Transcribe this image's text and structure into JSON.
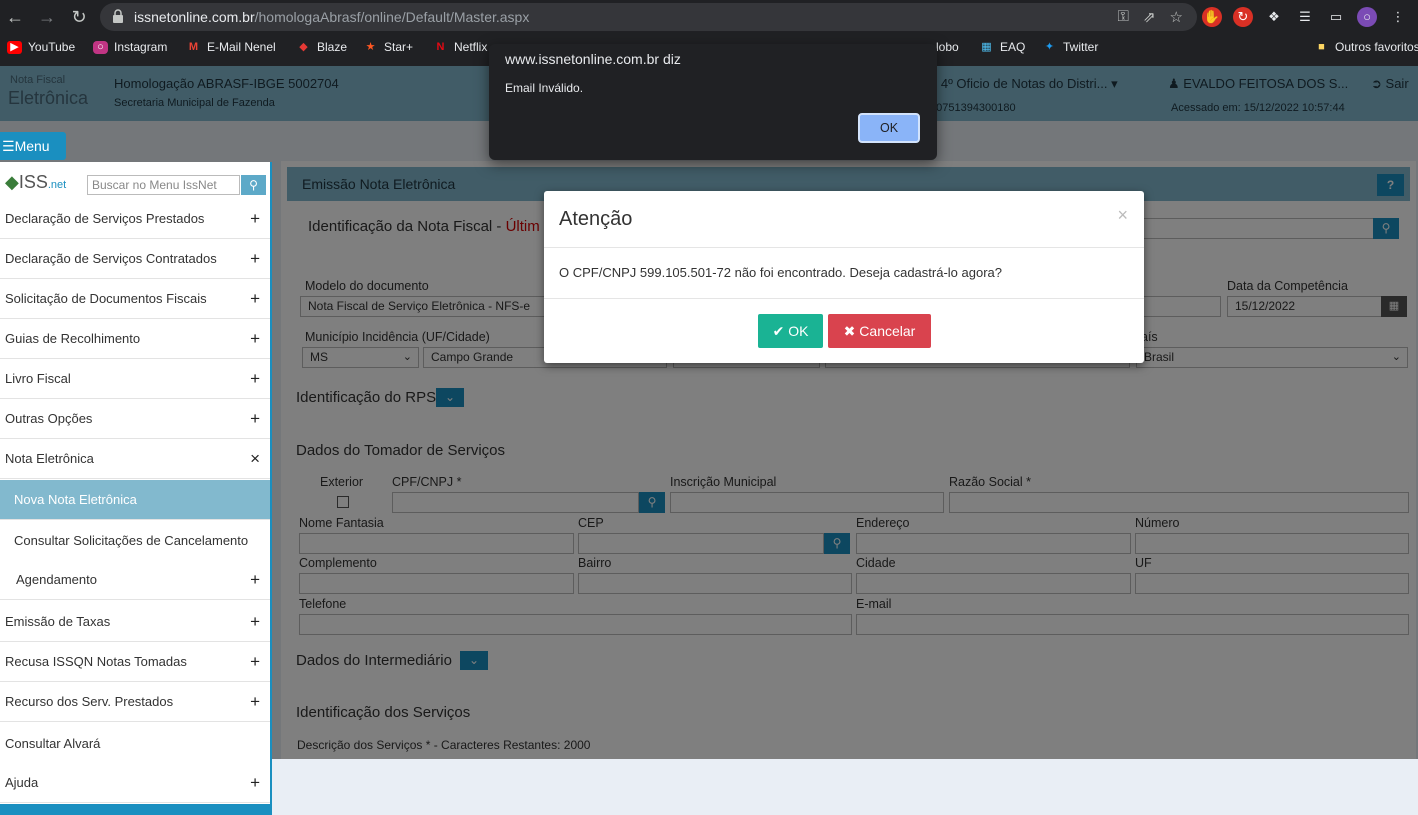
{
  "browser": {
    "url_host": "issnetonline.com.br",
    "url_path": "/homologaAbrasf/online/Default/Master.aspx",
    "bookmarks": [
      "YouTube",
      "Instagram",
      "E-Mail Nenel",
      "Blaze",
      "Star+",
      "Netflix",
      "lobo",
      "EAQ",
      "Twitter",
      "Outros favoritos"
    ]
  },
  "header": {
    "logo_line1": "Nota Fiscal",
    "logo_line2": "Eletrônica",
    "title": "Homologação ABRASF-IBGE 5002704",
    "subtitle": "Secretaria Municipal de Fazenda",
    "org": "o 4º Oficio de Notas do Distri...",
    "im": ": 0751394300180",
    "user": "EVALDO FEITOSA DOS S...",
    "access": "Acessado em: 15/12/2022 10:57:44",
    "exit": "Sair"
  },
  "menu_button": "Menu",
  "sidebar": {
    "logo": "ISS",
    "logo_suffix": ".net",
    "search_placeholder": "Buscar no Menu IssNet",
    "items": [
      {
        "label": "Declaração de Serviços Prestados",
        "sign": "+"
      },
      {
        "label": "Declaração de Serviços Contratados",
        "sign": "+"
      },
      {
        "label": "Solicitação de Documentos Fiscais",
        "sign": "+"
      },
      {
        "label": "Guias de Recolhimento",
        "sign": "+"
      },
      {
        "label": "Livro Fiscal",
        "sign": "+"
      },
      {
        "label": "Outras Opções",
        "sign": "+"
      },
      {
        "label": "Nota Eletrônica",
        "sign": "×"
      },
      {
        "label": "Nova Nota Eletrônica",
        "sign": ""
      },
      {
        "label": "Consultar Solicitações de Cancelamento",
        "sign": ""
      },
      {
        "label": "Agendamento",
        "sign": "+"
      },
      {
        "label": "Emissão de Taxas",
        "sign": "+"
      },
      {
        "label": "Recusa ISSQN Notas Tomadas",
        "sign": "+"
      },
      {
        "label": "Recurso dos Serv. Prestados",
        "sign": "+"
      },
      {
        "label": "Consultar Alvará",
        "sign": ""
      },
      {
        "label": "Ajuda",
        "sign": "+"
      }
    ]
  },
  "main": {
    "panel_title": "Emissão Nota Eletrônica",
    "help": "?",
    "ident_title": "Identificação da Nota Fiscal - ",
    "ident_title_red": "Últim",
    "modelo_label": "Modelo do documento",
    "modelo_value": "Nota Fiscal de Serviço Eletrônica - NFS-e",
    "competencia_label": "Data da Competência",
    "competencia_value": "15/12/2022",
    "municipio_label": "Município Incidência (UF/Cidade)",
    "uf_value": "MS",
    "cidade_value": "Campo Grande",
    "pais_label": "aís",
    "pais_value": "Brasil",
    "rps_title": "Identificação do RPS",
    "tomador_title": "Dados do Tomador de Serviços",
    "exterior_label": "Exterior",
    "cpf_label": "CPF/CNPJ *",
    "im_label": "Inscrição Municipal",
    "razao_label": "Razão Social *",
    "fantasia_label": "Nome Fantasia",
    "cep_label": "CEP",
    "endereco_label": "Endereço",
    "numero_label": "Número",
    "complemento_label": "Complemento",
    "bairro_label": "Bairro",
    "cidade_label": "Cidade",
    "uf_label": "UF",
    "telefone_label": "Telefone",
    "email_label": "E-mail",
    "intermediario_title": "Dados do Intermediário",
    "servicos_title": "Identificação dos Serviços",
    "descricao_label": "Descrição dos Serviços * - Caracteres Restantes: 2000"
  },
  "modal": {
    "title": "Atenção",
    "close": "×",
    "body": "O CPF/CNPJ 599.105.501-72 não foi encontrado. Deseja cadastrá-lo agora?",
    "ok": "OK",
    "cancel": "Cancelar"
  },
  "alert": {
    "title": "www.issnetonline.com.br diz",
    "message": "Email Inválido.",
    "ok": "OK"
  },
  "colors": {
    "header": "#82b9ce",
    "primary": "#1a8fc0",
    "ok_green": "#1ab394",
    "cancel_red": "#d9434e"
  }
}
